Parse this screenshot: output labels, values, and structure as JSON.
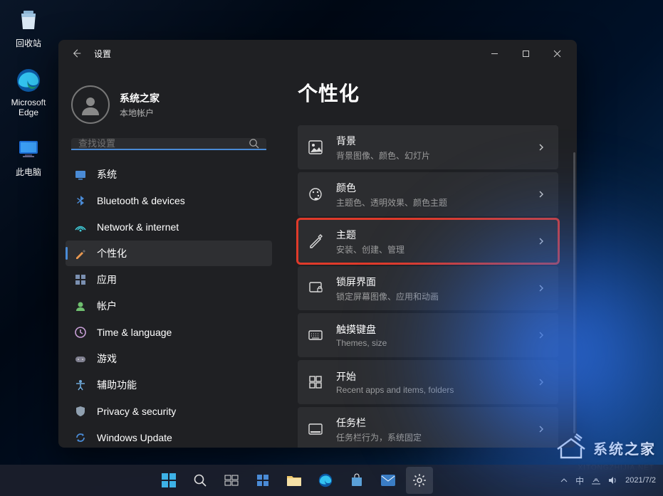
{
  "desktop": {
    "icons": [
      {
        "name": "recycle-bin",
        "label": "回收站"
      },
      {
        "name": "edge",
        "label": "Microsoft\nEdge"
      },
      {
        "name": "this-pc",
        "label": "此电脑"
      }
    ]
  },
  "window": {
    "title": "设置",
    "account": {
      "name": "系统之家",
      "type": "本地帐户"
    },
    "search_placeholder": "查找设置",
    "nav": [
      {
        "id": "system",
        "label": "系统"
      },
      {
        "id": "bluetooth",
        "label": "Bluetooth & devices"
      },
      {
        "id": "network",
        "label": "Network & internet"
      },
      {
        "id": "personalization",
        "label": "个性化",
        "active": true
      },
      {
        "id": "apps",
        "label": "应用"
      },
      {
        "id": "accounts",
        "label": "帐户"
      },
      {
        "id": "time",
        "label": "Time & language"
      },
      {
        "id": "gaming",
        "label": "游戏"
      },
      {
        "id": "accessibility",
        "label": "辅助功能"
      },
      {
        "id": "privacy",
        "label": "Privacy & security"
      },
      {
        "id": "update",
        "label": "Windows Update"
      }
    ],
    "page_title": "个性化",
    "cards": [
      {
        "id": "background",
        "title": "背景",
        "desc": "背景图像、颜色、幻灯片"
      },
      {
        "id": "colors",
        "title": "颜色",
        "desc": "主题色、透明效果、颜色主题"
      },
      {
        "id": "themes",
        "title": "主题",
        "desc": "安装、创建、管理",
        "highlight": true
      },
      {
        "id": "lockscreen",
        "title": "锁屏界面",
        "desc": "锁定屏幕图像、应用和动画"
      },
      {
        "id": "touchkbd",
        "title": "触摸键盘",
        "desc": "Themes, size"
      },
      {
        "id": "start",
        "title": "开始",
        "desc": "Recent apps and items, folders"
      },
      {
        "id": "taskbar",
        "title": "任务栏",
        "desc": "任务栏行为，系统固定"
      }
    ]
  },
  "watermark": {
    "text": "系统之家",
    "sub": "XITONGZHIJIA.NET"
  },
  "tray": {
    "date": "2021/7/2"
  }
}
